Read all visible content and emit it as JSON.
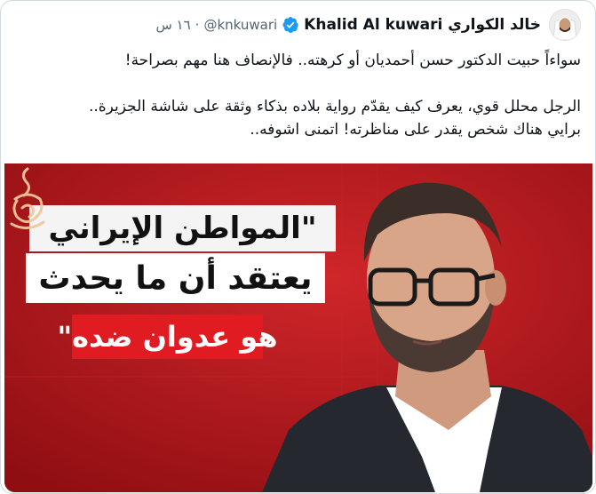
{
  "tweet": {
    "author_name": "Khalid Al kuwari خالد الكواري",
    "handle": "@knkuwari",
    "separator": "·",
    "time": "١٦ س",
    "verified": true,
    "text_line_1": "سواءاً حبيت الدكتور حسن أحمديان أو كرهته.. فالإنصاف هنا مهم بصراحة!",
    "text_line_2": "الرجل محلل قوي، يعرف كيف يقدّم رواية بلاده بذكاء وثقة على شاشة الجزيرة..",
    "text_line_3": "برايي هناك شخص يقدر على مناظرته! اتمنى اشوفه.."
  },
  "media": {
    "banner_line_1": "\"المواطن الإيراني",
    "banner_line_2": "يعتقد أن ما يحدث",
    "banner_line_3": "هو عدوان ضده\"",
    "logo": "aljazeera-logo"
  },
  "colors": {
    "verified_blue": "#1d9bf0",
    "handle_gray": "#536471",
    "background_red": "#b5161a",
    "accent_red": "#e11b22"
  }
}
